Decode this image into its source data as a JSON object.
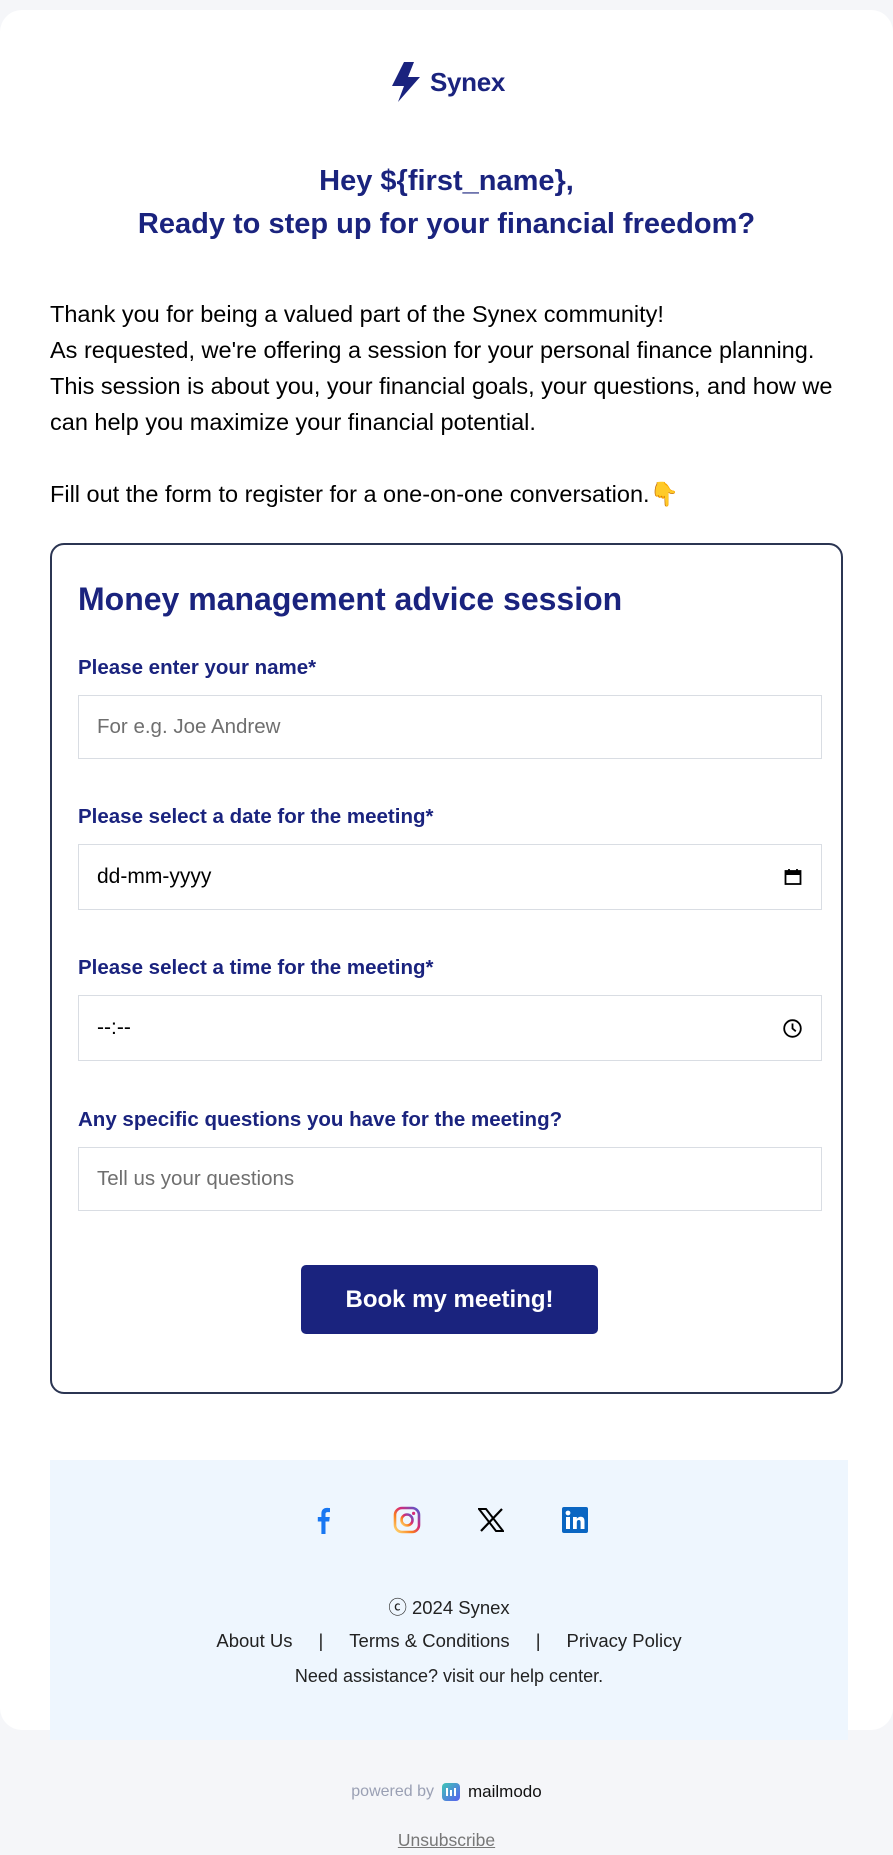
{
  "brand": {
    "name": "Synex",
    "color": "#1a237e"
  },
  "headline": {
    "line1": "Hey ${first_name},",
    "line2": "Ready to step up for your financial freedom?"
  },
  "intro": {
    "p1": "Thank you for being a valued part of the Synex community!",
    "p2": "As requested, we're offering a session for your personal finance planning. This session is about you, your financial goals, your questions, and how we can help you maximize your financial potential.",
    "cta": "Fill out the form to register for a one-on-one conversation.",
    "cta_emoji": "👇"
  },
  "form": {
    "title": "Money management advice session",
    "name_label": "Please enter your name*",
    "name_placeholder": "For e.g. Joe Andrew",
    "date_label": "Please select a date for the meeting*",
    "date_value": "dd-mm-yyyy",
    "time_label": "Please select a time for the meeting*",
    "time_value": "--:--",
    "questions_label": "Any specific questions you have for the meeting?",
    "questions_placeholder": "Tell us your questions",
    "submit_label": "Book my meeting!"
  },
  "footer": {
    "socials": [
      "facebook-icon",
      "instagram-icon",
      "x-icon",
      "linkedin-icon"
    ],
    "copyright": "ⓒ 2024 Synex",
    "links": [
      "About Us",
      "Terms & Conditions",
      "Privacy Policy"
    ],
    "separator": "|",
    "help": "Need assistance? visit our help center."
  },
  "powered_by": {
    "prefix": "powered by",
    "name": "mailmodo"
  },
  "unsubscribe": "Unsubscribe"
}
